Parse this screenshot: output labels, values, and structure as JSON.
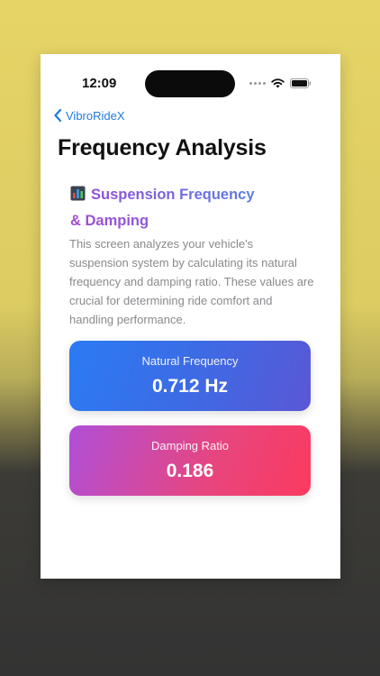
{
  "status_bar": {
    "time": "12:09",
    "signal_icon": "cellular-dots-icon",
    "wifi_icon": "wifi-icon",
    "battery_icon": "battery-icon"
  },
  "nav": {
    "back_icon": "chevron-left-icon",
    "back_label": "VibroRideX"
  },
  "page": {
    "title": "Frequency Analysis"
  },
  "section": {
    "icon": "bar-chart-icon",
    "title_line1": "Suspension Frequency",
    "title_line2": "& Damping",
    "description": "This screen analyzes your vehicle's suspension system by calculating its natural frequency and damping ratio. These values are crucial for determining ride comfort and handling performance."
  },
  "metrics": {
    "natural_frequency": {
      "label": "Natural Frequency",
      "value": "0.712 Hz"
    },
    "damping_ratio": {
      "label": "Damping Ratio",
      "value": "0.186"
    }
  },
  "colors": {
    "accent_blue": "#1f7ae0",
    "frequency_card_start": "#2b7bf4",
    "frequency_card_end": "#5a57d6",
    "damping_card_start": "#b04fd8",
    "damping_card_end": "#fb3a5f",
    "title_gradient_start": "#8f4fd6",
    "title_gradient_end": "#5a7fe3"
  }
}
